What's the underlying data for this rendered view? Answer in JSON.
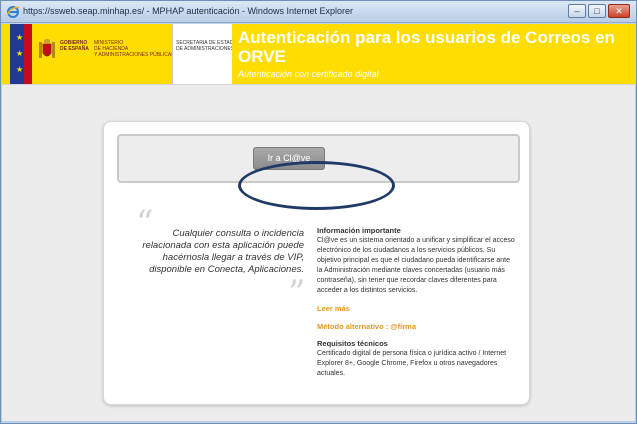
{
  "window": {
    "title": "https://ssweb.seap.minhap.es/ - MPHAP autenticación - Windows Internet Explorer",
    "minimize_glyph": "–",
    "maximize_glyph": "□",
    "close_glyph": "✕"
  },
  "header": {
    "gobierno_label": "GOBIERNO\nDE ESPAÑA",
    "ministry_label": "MINISTERIO\nDE HACIENDA\nY ADMINISTRACIONES PÚBLICAS",
    "secretaria_label": "SECRETARÍA DE ESTADO\nDE ADMINISTRACIONES",
    "app_title": "Autenticación para los usuarios de Correos en ORVE",
    "app_subtitle": "Autenticación con certificado digital",
    "colors": {
      "banner": "#ffdd00",
      "accent_link": "#e8951e",
      "ellipse": "#1f3a66"
    }
  },
  "main": {
    "clave_button_label": "Ir a Cl@ve",
    "quote_open": "“",
    "quote_close": "”",
    "quote_text": "Cualquier consulta o incidencia relacionada con esta aplicación puede hacérnosla llegar a través de VIP, disponible en Conecta, Aplicaciones.",
    "info_heading": "Información importante",
    "info_body": "Cl@ve es un sistema orientado a unificar y simplificar el acceso electrónico de los ciudadanos a los servicios públicos. Su objetivo principal es que el ciudadano pueda identificarse ante la Administración mediante claves concertadas (usuario más contraseña), sin tener que recordar claves diferentes para acceder a los distintos servicios.",
    "read_more_link": "Leer más",
    "alt_method_link": "Método alternativo : @firma",
    "req_heading": "Requisitos técnicos",
    "req_body": "Certificado digital de persona física o jurídica activo / Internet Explorer 8+, Google Chrome, Firefox u otros navegadores actuales."
  }
}
